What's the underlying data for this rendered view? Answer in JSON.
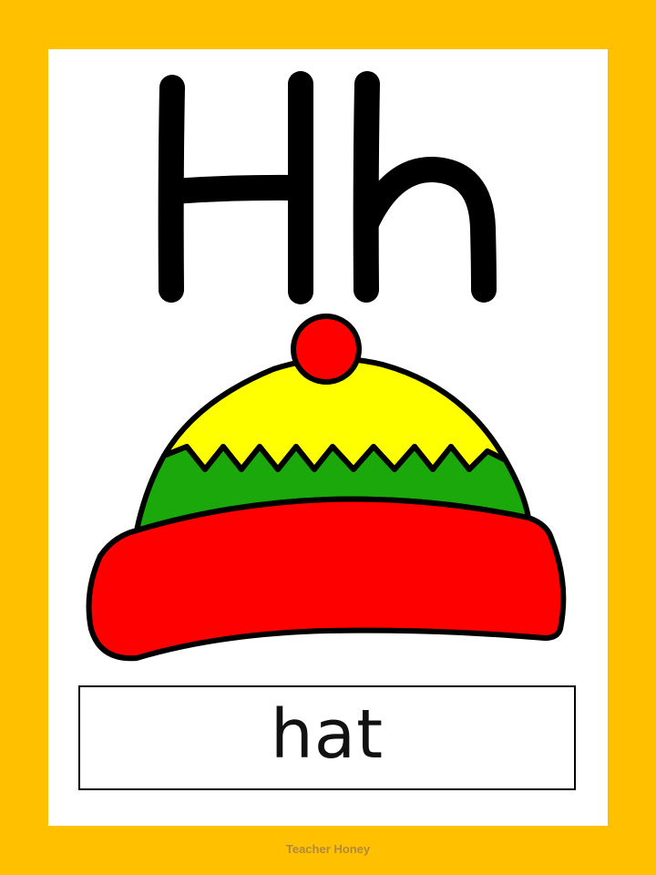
{
  "card": {
    "letter_upper": "H",
    "letter_lower": "h",
    "word": "hat",
    "credit": "Teacher Honey"
  },
  "picture": {
    "subject": "hat-icon",
    "colors": {
      "border": "#FFC000",
      "hat_brim": "#FF0000",
      "hat_band": "#1BA80A",
      "hat_top": "#FFFF00",
      "pompom": "#FF0000",
      "outline": "#000000"
    }
  }
}
